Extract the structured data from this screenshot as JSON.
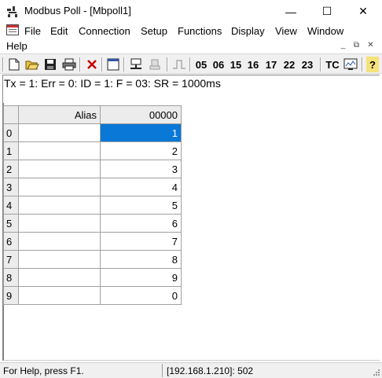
{
  "window": {
    "title": "Modbus Poll - [Mbpoll1]",
    "minimize": "—",
    "maximize": "☐",
    "close": "✕"
  },
  "menu": [
    "File",
    "Edit",
    "Connection",
    "Setup",
    "Functions",
    "Display",
    "View",
    "Window",
    "Help"
  ],
  "mdi_controls": {
    "minimize": "_",
    "restore": "⧉",
    "close": "✕"
  },
  "toolbar": {
    "function_codes": [
      "05",
      "06",
      "15",
      "16",
      "17",
      "22",
      "23"
    ],
    "tc_label": "TC",
    "help_label": "?"
  },
  "status_line": "Tx = 1: Err = 0: ID = 1: F = 03: SR = 1000ms",
  "grid": {
    "headers": {
      "alias": "Alias",
      "address": "00000"
    },
    "rows": [
      {
        "index": "0",
        "alias": "",
        "value": "1"
      },
      {
        "index": "1",
        "alias": "",
        "value": "2"
      },
      {
        "index": "2",
        "alias": "",
        "value": "3"
      },
      {
        "index": "3",
        "alias": "",
        "value": "4"
      },
      {
        "index": "4",
        "alias": "",
        "value": "5"
      },
      {
        "index": "5",
        "alias": "",
        "value": "6"
      },
      {
        "index": "6",
        "alias": "",
        "value": "7"
      },
      {
        "index": "7",
        "alias": "",
        "value": "8"
      },
      {
        "index": "8",
        "alias": "",
        "value": "9"
      },
      {
        "index": "9",
        "alias": "",
        "value": "0"
      }
    ],
    "selected_row": 0
  },
  "statusbar": {
    "help_text": "For Help, press F1.",
    "connection": "[192.168.1.210]: 502"
  },
  "colors": {
    "selection": "#0a78d7",
    "toolbar_bg": "#f0f0f0",
    "stop_red": "#cc0000"
  }
}
